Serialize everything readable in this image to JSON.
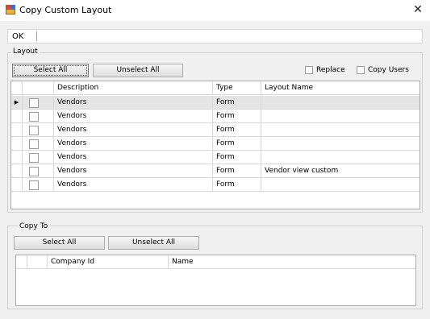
{
  "window": {
    "title": "Copy Custom Layout",
    "close_glyph": "✕",
    "icon": "app-layout-icon"
  },
  "toolbar": {
    "ok_label": "OK"
  },
  "layout_group": {
    "title": "Layout",
    "select_all_label": "Select All",
    "unselect_all_label": "Unselect All",
    "replace_label": "Replace",
    "copy_users_label": "Copy Users",
    "columns": [
      "Description",
      "Type",
      "Layout Name"
    ],
    "row_indicator_glyph": "▶",
    "rows": [
      {
        "description": "Vendors",
        "type": "Form",
        "layout_name": ""
      },
      {
        "description": "Vendors",
        "type": "Form",
        "layout_name": ""
      },
      {
        "description": "Vendors",
        "type": "Form",
        "layout_name": ""
      },
      {
        "description": "Vendors",
        "type": "Form",
        "layout_name": ""
      },
      {
        "description": "Vendors",
        "type": "Form",
        "layout_name": ""
      },
      {
        "description": "Vendors",
        "type": "Form",
        "layout_name": "Vendor view custom"
      },
      {
        "description": "Vendors",
        "type": "Form",
        "layout_name": ""
      }
    ]
  },
  "copy_to_group": {
    "title": "Copy To",
    "select_all_label": "Select All",
    "unselect_all_label": "Unselect All",
    "columns": [
      "Company Id",
      "Name"
    ]
  }
}
